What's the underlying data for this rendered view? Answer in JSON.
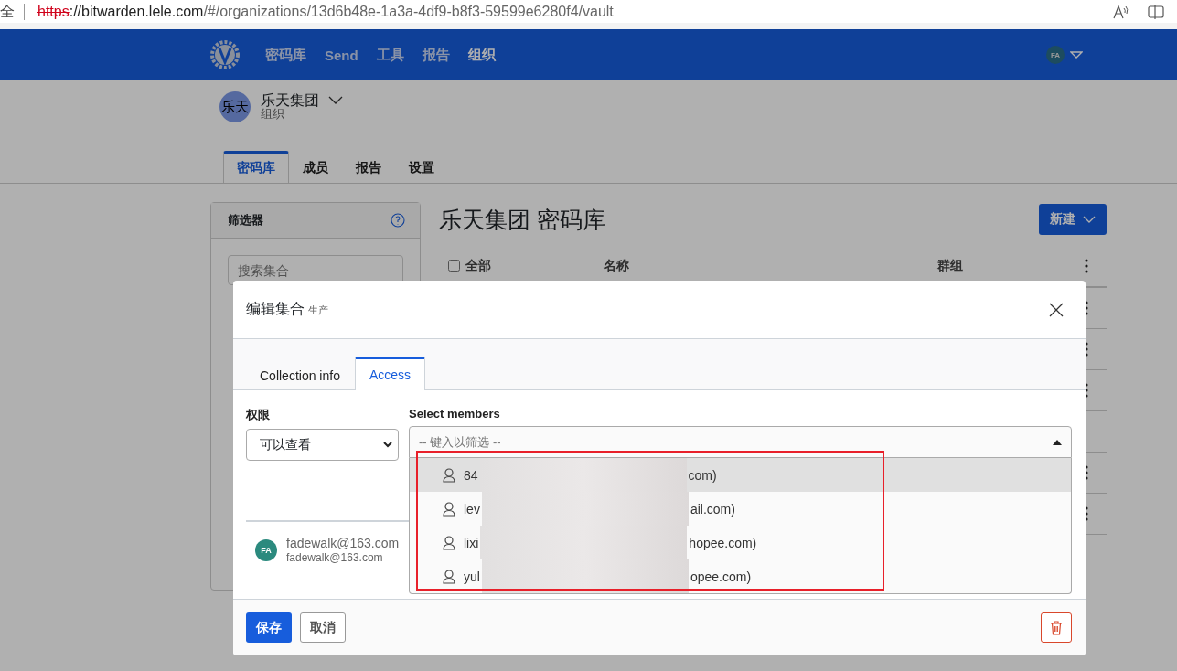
{
  "browser": {
    "security_label": "全",
    "url": {
      "scheme": "https",
      "host": "://bitwarden.lele.com",
      "path": "/#/organizations/13d6b48e-1a3a-4df9-b8f3-59599e6280f4/vault"
    }
  },
  "nav": {
    "items": [
      {
        "label": "密码库",
        "selected": false
      },
      {
        "label": "Send",
        "selected": false
      },
      {
        "label": "工具",
        "selected": false
      },
      {
        "label": "报告",
        "selected": false
      },
      {
        "label": "组织",
        "selected": true
      }
    ],
    "avatar": "FA"
  },
  "org": {
    "initials": "乐天",
    "name": "乐天集团",
    "type": "组织"
  },
  "tabs": [
    {
      "label": "密码库",
      "selected": true
    },
    {
      "label": "成员",
      "selected": false
    },
    {
      "label": "报告",
      "selected": false
    },
    {
      "label": "设置",
      "selected": false
    }
  ],
  "filter": {
    "title": "筛选器",
    "search_placeholder": "搜索集合"
  },
  "vault": {
    "title": "乐天集团 密码库",
    "new_button": "新建",
    "columns": [
      "全部",
      "名称",
      "群组"
    ],
    "all_checked": false,
    "rows": [
      {
        "menu": true
      },
      {
        "menu": true
      },
      {
        "menu": true
      },
      {
        "menu": false
      },
      {
        "menu": true
      },
      {
        "menu": true
      }
    ]
  },
  "dialog": {
    "title": "编辑集合",
    "subtitle": "生产",
    "tabs": [
      {
        "label": "Collection info",
        "selected": false
      },
      {
        "label": "Access",
        "selected": true
      }
    ],
    "permission": {
      "label": "权限",
      "value": "可以查看"
    },
    "members": {
      "label": "Select members",
      "placeholder": "-- 键入以筛选 --",
      "expanded": true,
      "highlighted": true,
      "options": [
        {
          "start": "84",
          "end": "com)",
          "selected": true
        },
        {
          "start": "lev",
          "end": "ail.com)",
          "selected": false
        },
        {
          "start": "lixi",
          "end": "hopee.com)",
          "selected": false
        },
        {
          "start": "yul",
          "end": "opee.com)",
          "selected": false
        }
      ]
    },
    "assigned": [
      {
        "initials": "FA",
        "name": "fadewalk@163.com",
        "email": "fadewalk@163.com",
        "color": "#2b8a7e"
      }
    ],
    "save": "保存",
    "cancel": "取消"
  }
}
